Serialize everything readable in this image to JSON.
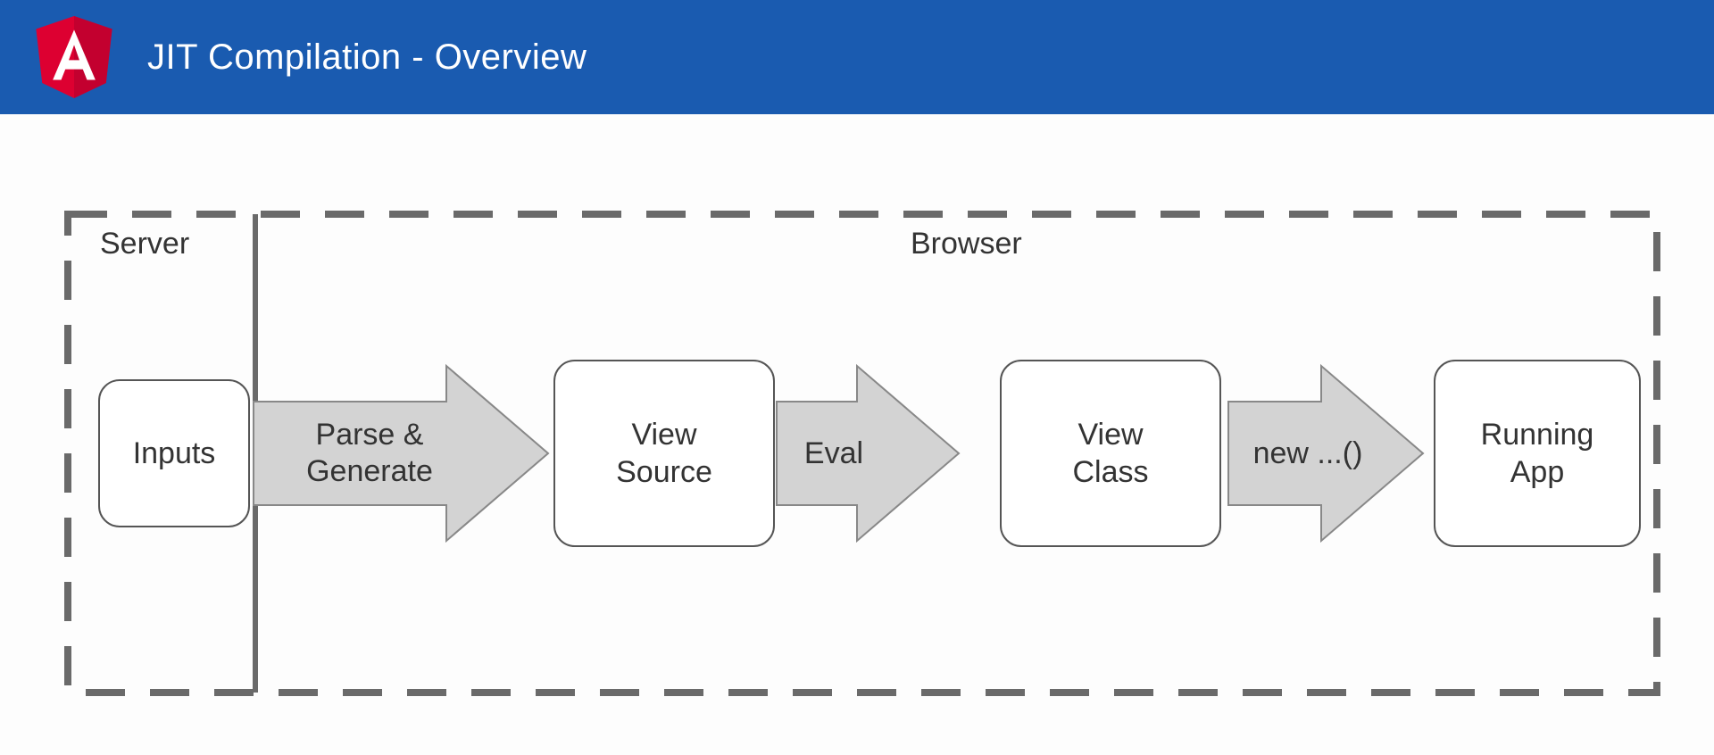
{
  "header": {
    "title": "JIT Compilation - Overview",
    "logo_letter": "A"
  },
  "regions": {
    "server": "Server",
    "browser": "Browser"
  },
  "boxes": {
    "inputs": "Inputs",
    "view_source": "View\nSource",
    "view_class": "View\nClass",
    "running_app": "Running\nApp"
  },
  "arrows": {
    "parse_generate": "Parse &\nGenerate",
    "eval": "Eval",
    "new": "new ...()"
  }
}
